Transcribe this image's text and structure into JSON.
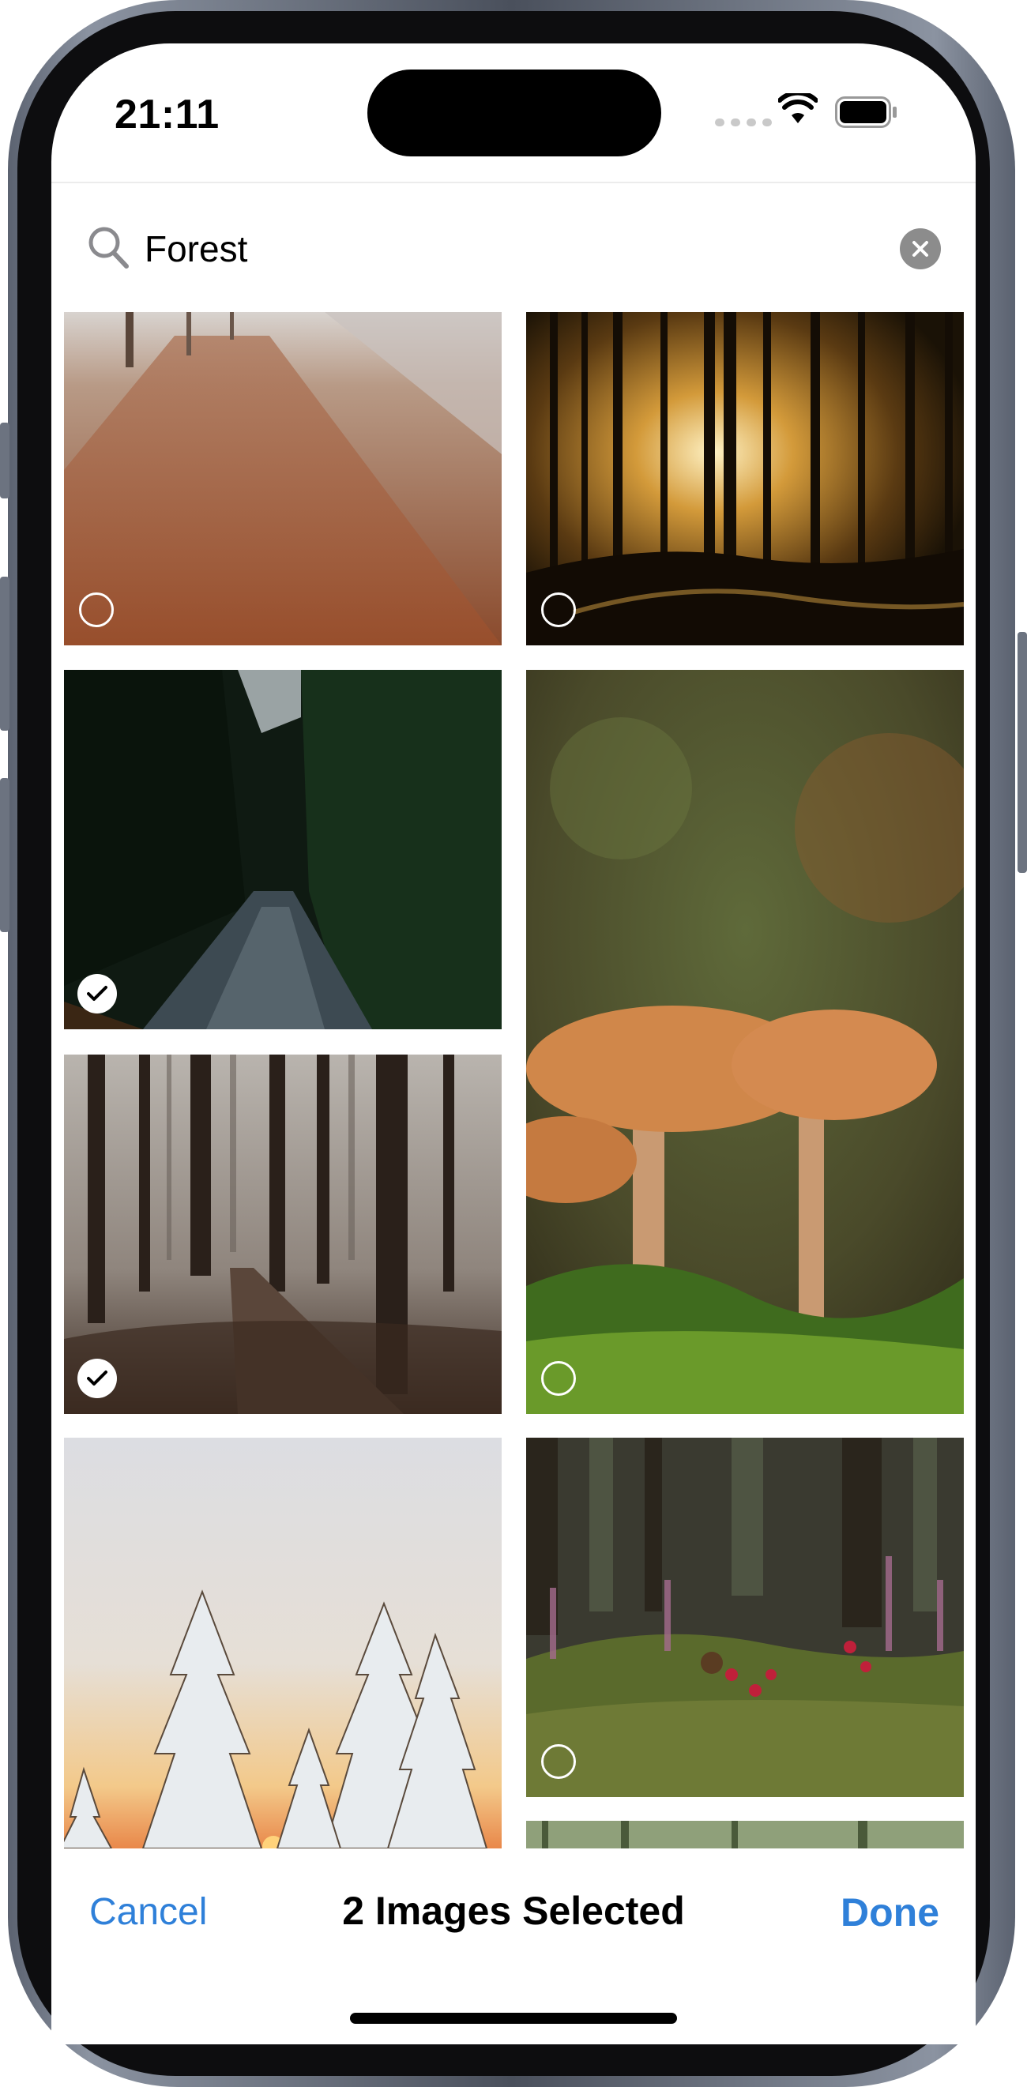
{
  "status_bar": {
    "time": "21:11"
  },
  "search": {
    "query": "Forest",
    "placeholder": "Search"
  },
  "photos": [
    {
      "name": "frosty-leaf-path",
      "selected": false
    },
    {
      "name": "sunbeams-forest",
      "selected": false
    },
    {
      "name": "dark-road-forest",
      "selected": true
    },
    {
      "name": "mushrooms-moss",
      "selected": false
    },
    {
      "name": "foggy-boardwalk-forest",
      "selected": true
    },
    {
      "name": "snowy-trees-sunset",
      "selected": false
    },
    {
      "name": "berries-heather-moss",
      "selected": false
    },
    {
      "name": "partial-forest-photo",
      "selected": false
    }
  ],
  "toolbar": {
    "cancel_label": "Cancel",
    "selection_label": "2 Images Selected",
    "done_label": "Done"
  },
  "colors": {
    "accent": "#2f80d9"
  }
}
